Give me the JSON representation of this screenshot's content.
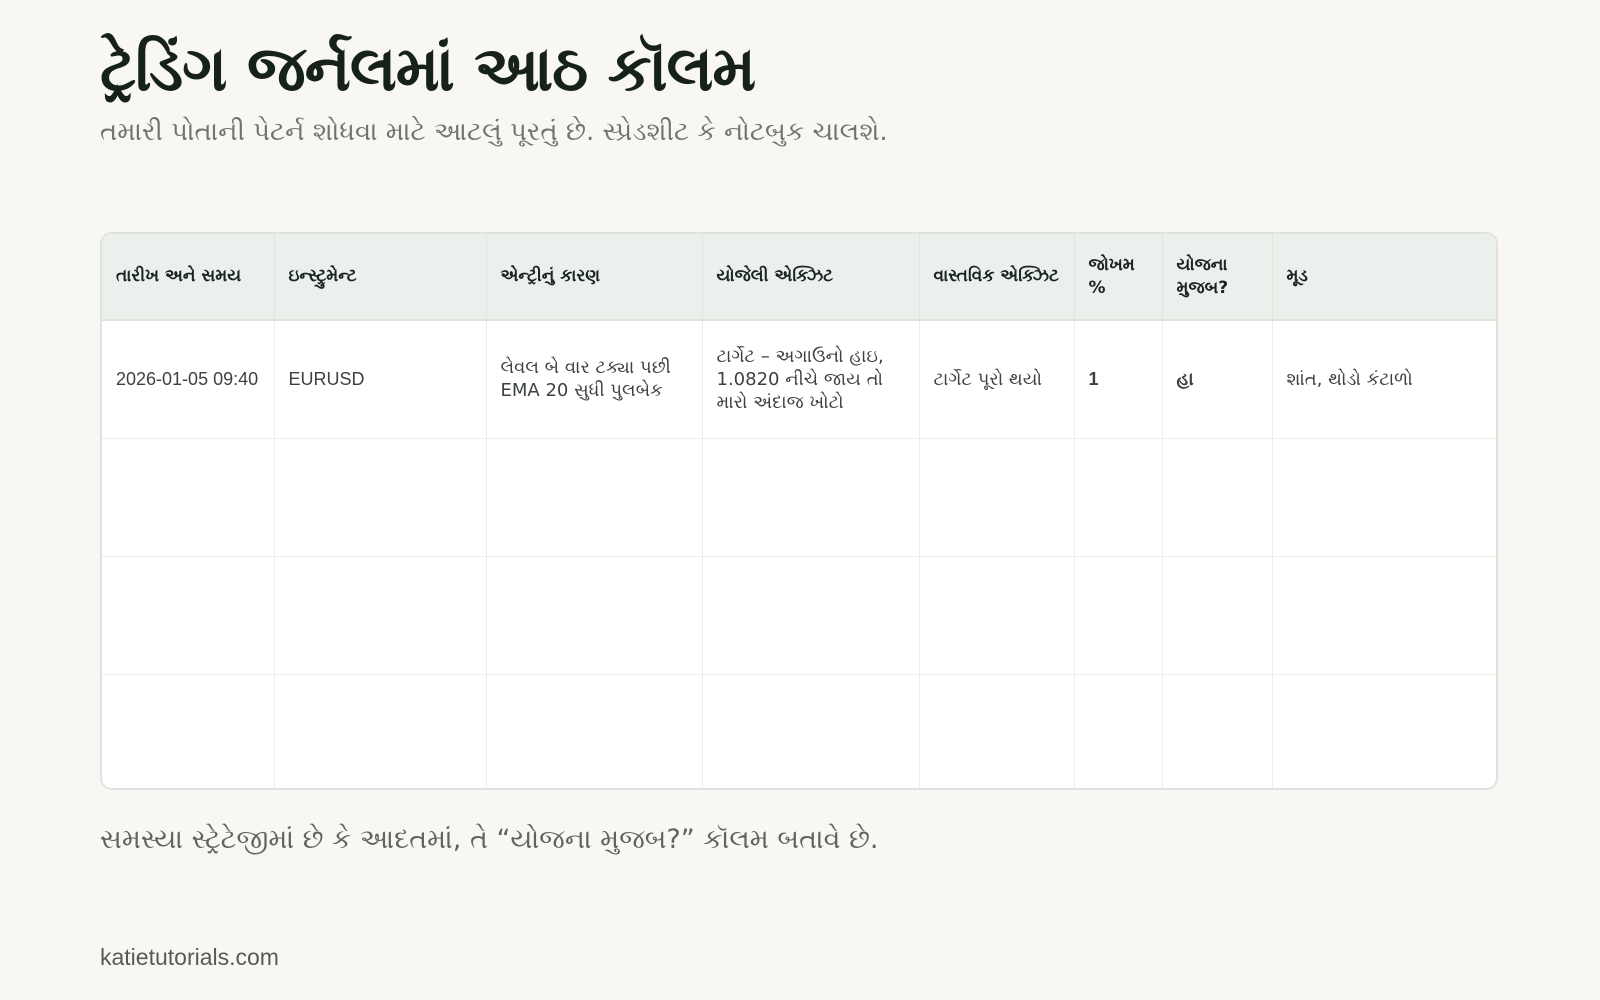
{
  "header": {
    "title": "ટ્રેડિંગ જર્નલમાં આઠ કૉલમ",
    "subtitle": "તમારી પોતાની પેટર્ન શોધવા માટે આટલું પૂરતું છે. સ્પ્રેડશીટ કે નોટબુક ચાલશે."
  },
  "table": {
    "columns": [
      "તારીખ અને સમય",
      "ઇન્સ્ટ્રુમેન્ટ",
      "એન્ટ્રીનું કારણ",
      "યોજેલી એક્ઝિટ",
      "વાસ્તવિક એક્ઝિટ",
      "જોખમ %",
      "યોજના મુજબ?",
      "મૂડ"
    ],
    "rows": [
      {
        "datetime": "2026-01-05 09:40",
        "instrument": "EURUSD",
        "entry_reason": "લેવલ બે વાર ટક્યા પછી EMA 20 સુધી પુલબેક",
        "planned_exit": "ટાર્ગેટ – અગાઉનો હાઇ, 1.0820 નીચે જાય તો મારો અંદાજ ખોટો",
        "actual_exit": "ટાર્ગેટ પૂરો થયો",
        "risk": "1",
        "per_plan": "હા",
        "mood": "શાંત, થોડો કંટાળો"
      }
    ],
    "empty_row_count": 3
  },
  "footer": {
    "note": "સમસ્યા સ્ટ્રેટેજીમાં છે કે આદતમાં, તે “યોજના મુજબ?” કૉલમ બતાવે છે.",
    "site": "katietutorials.com"
  },
  "colors": {
    "background": "#f8f7f3",
    "header_bg": "#ebf0ec",
    "accent_green": "#1f7a52"
  }
}
